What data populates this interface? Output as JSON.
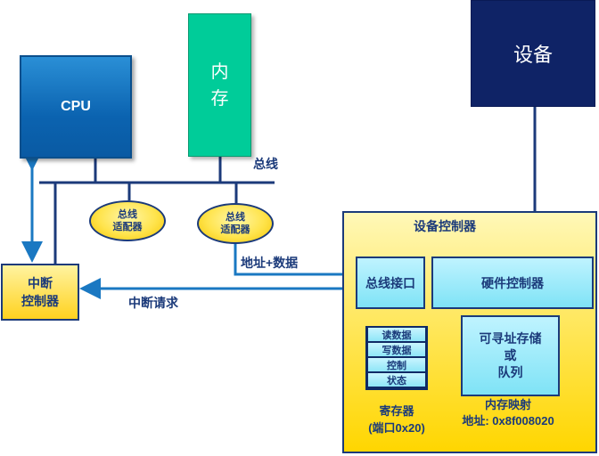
{
  "cpu": {
    "label": "CPU"
  },
  "memory": {
    "line1": "内",
    "line2": "存"
  },
  "device": {
    "label": "设备"
  },
  "bus": {
    "label": "总线"
  },
  "adapters": [
    {
      "line1": "总线",
      "line2": "适配器"
    },
    {
      "line1": "总线",
      "line2": "适配器"
    }
  ],
  "interrupt_controller": {
    "line1": "中断",
    "line2": "控制器"
  },
  "labels": {
    "address_data": "地址+数据",
    "interrupt_request": "中断请求"
  },
  "device_controller": {
    "title": "设备控制器",
    "bus_interface": "总线接口",
    "hardware_controller": "硬件控制器",
    "queue": {
      "line1": "可寻址存储",
      "line2": "或",
      "line3": "队列"
    },
    "registers": [
      "读数据",
      "写数据",
      "控制",
      "状态"
    ],
    "registers_caption": {
      "line1": "寄存器",
      "line2": "(端口0x20)"
    },
    "memory_map_caption": {
      "line1": "内存映射",
      "line2": "地址: 0x8f008020"
    }
  },
  "colors": {
    "wire": "#1b3a7a",
    "arrow": "#1a78c2"
  }
}
